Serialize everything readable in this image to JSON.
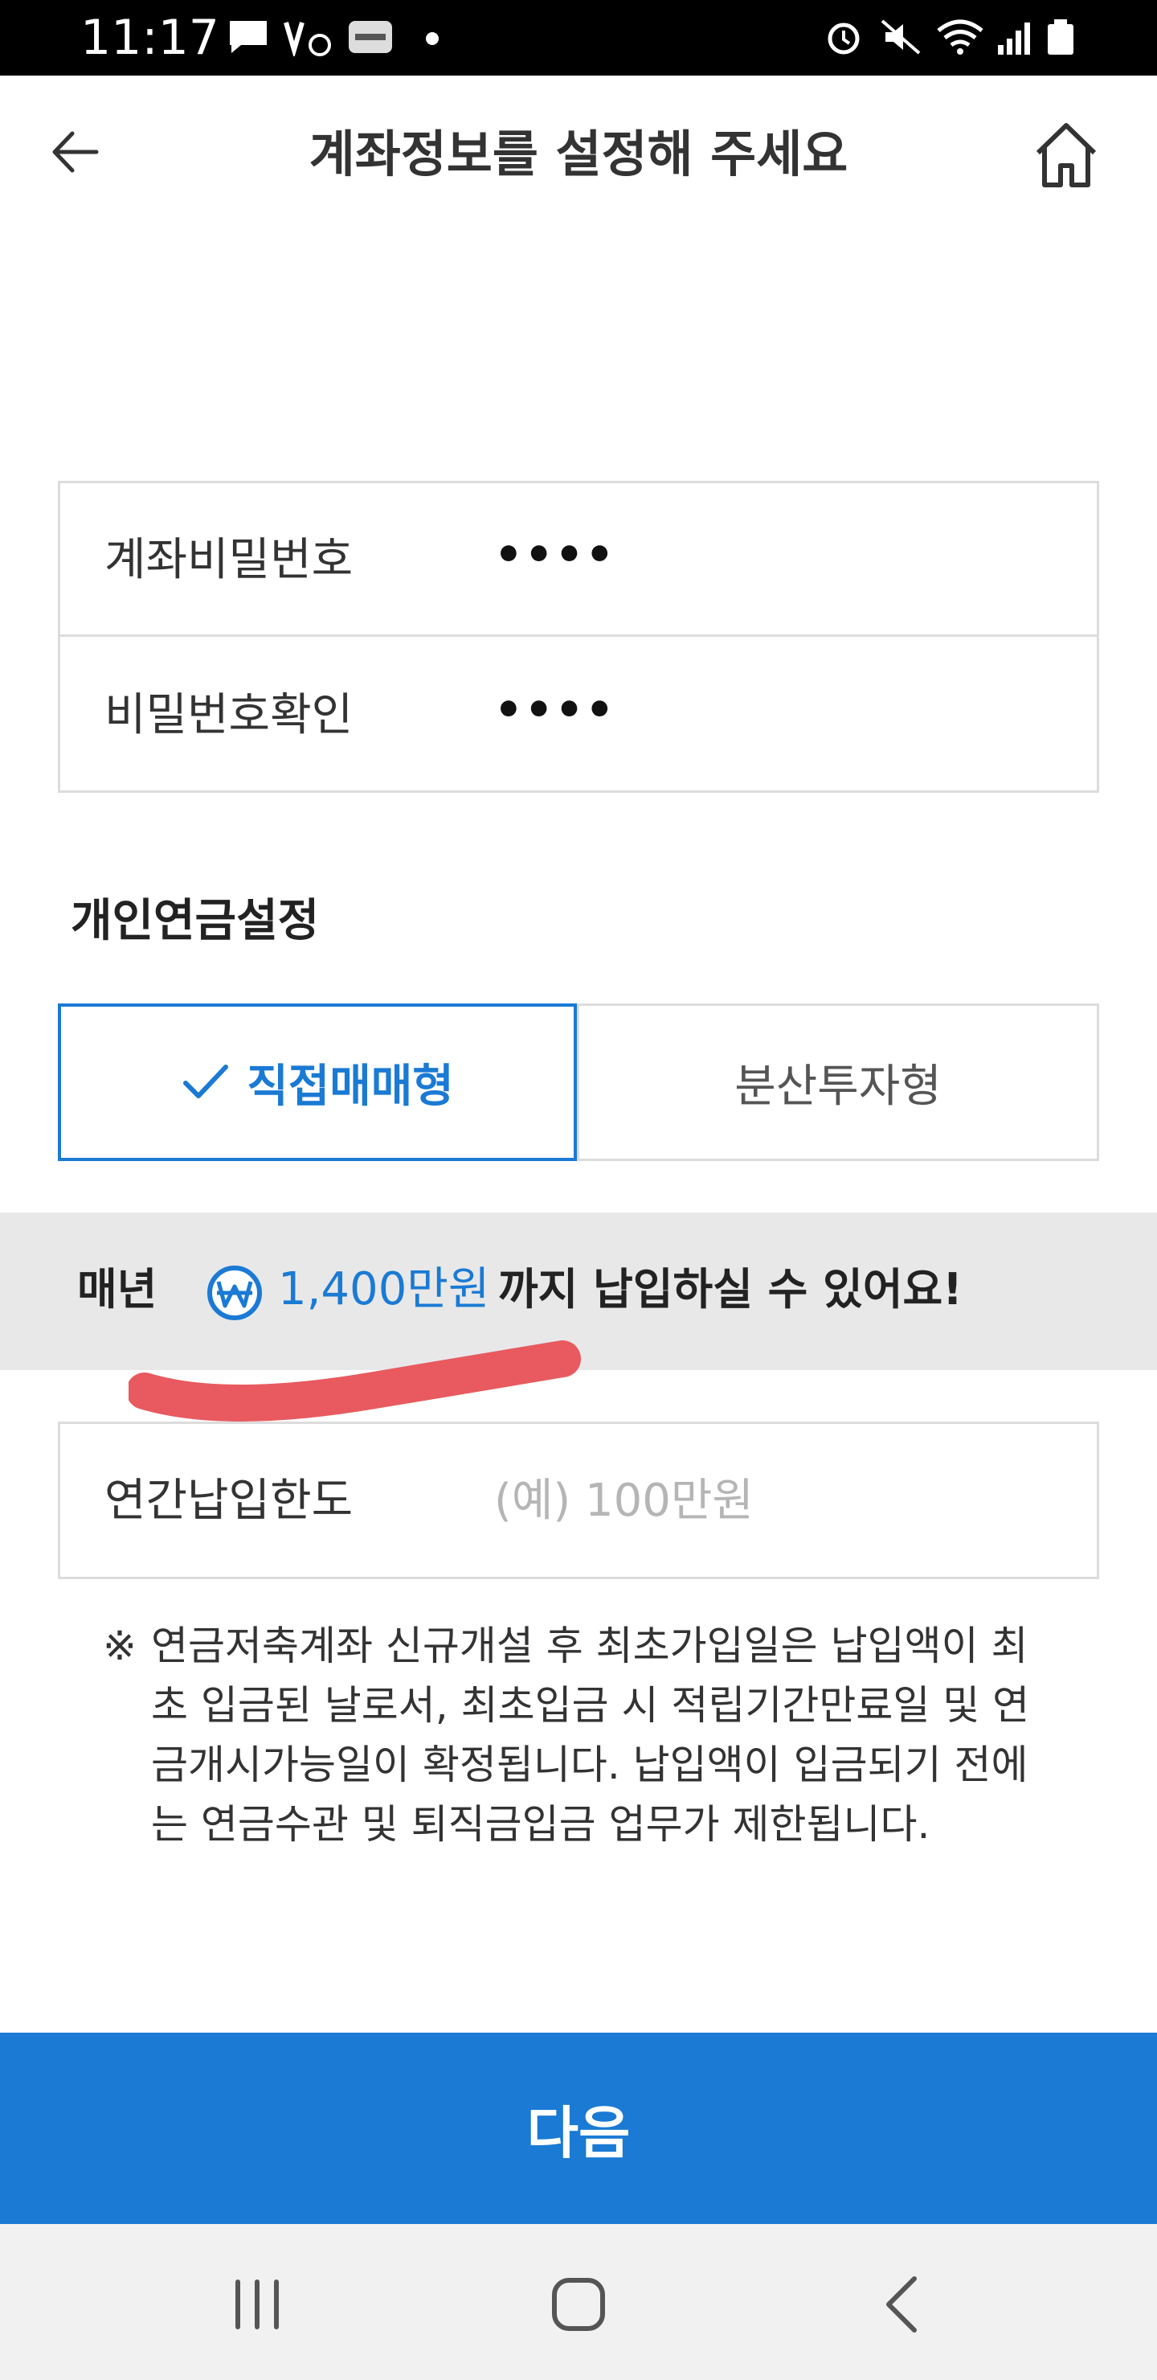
{
  "status_bar": {
    "time": "11:17"
  },
  "header": {
    "title": "계좌정보를 설정해 주세요"
  },
  "password_section": {
    "rows": [
      {
        "label": "계좌비밀번호",
        "value": "••••"
      },
      {
        "label": "비밀번호확인",
        "value": "••••"
      }
    ]
  },
  "pension_section": {
    "title": "개인연금설정",
    "options": [
      {
        "label": "직접매매형",
        "selected": true
      },
      {
        "label": "분산투자형",
        "selected": false
      }
    ]
  },
  "info_band": {
    "prefix": "매년",
    "amount": "1,400만원",
    "suffix": "까지 납입하실 수 있어요!"
  },
  "annual_limit": {
    "label": "연간납입한도",
    "placeholder": "(예) 100만원",
    "value": ""
  },
  "notice": {
    "mark": "※",
    "text": "연금저축계좌 신규개설 후 최초가입일은 납입액이 최초 입금된 날로서, 최초입금 시 적립기간만료일 및 연금개시가능일이 확정됩니다. 납입액이 입금되기 전에는 연금수관 및 퇴직금입금 업무가 제한됩니다."
  },
  "next_button": {
    "label": "다음"
  },
  "colors": {
    "accent": "#1a7ad4",
    "band": "#e8e8e8",
    "border": "#dcdcdc",
    "scribble": "#e85a5f"
  },
  "icons": {
    "back": "arrow-left-icon",
    "home": "home-icon",
    "check": "check-icon",
    "won": "won-circle-icon",
    "nav_recent": "recent-apps-icon",
    "nav_home": "nav-home-icon",
    "nav_back": "nav-back-icon"
  }
}
